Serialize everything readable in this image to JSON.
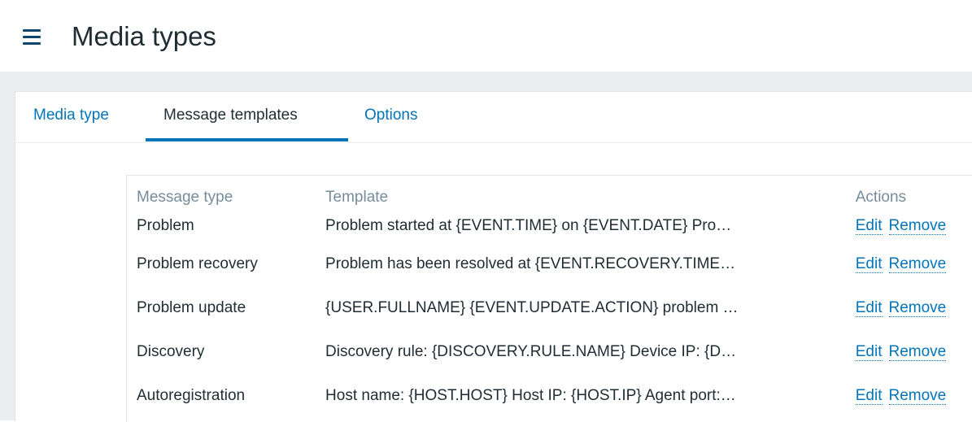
{
  "header": {
    "title": "Media types",
    "menu_icon": "hamburger-menu-icon"
  },
  "tabs": [
    {
      "label": "Media type",
      "active": false
    },
    {
      "label": "Message templates",
      "active": true
    },
    {
      "label": "Options",
      "active": false
    }
  ],
  "table": {
    "headers": {
      "message_type": "Message type",
      "template": "Template",
      "actions": "Actions"
    },
    "rows": [
      {
        "message_type": "Problem",
        "template": "Problem started at {EVENT.TIME} on {EVENT.DATE} Pro…",
        "edit": "Edit",
        "remove": "Remove"
      },
      {
        "message_type": "Problem recovery",
        "template": "Problem has been resolved at {EVENT.RECOVERY.TIME…",
        "edit": "Edit",
        "remove": "Remove"
      },
      {
        "message_type": "Problem update",
        "template": "{USER.FULLNAME} {EVENT.UPDATE.ACTION} problem …",
        "edit": "Edit",
        "remove": "Remove"
      },
      {
        "message_type": "Discovery",
        "template": "Discovery rule: {DISCOVERY.RULE.NAME} Device IP: {D…",
        "edit": "Edit",
        "remove": "Remove"
      },
      {
        "message_type": "Autoregistration",
        "template": "Host name: {HOST.HOST} Host IP: {HOST.IP} Agent port:…",
        "edit": "Edit",
        "remove": "Remove"
      }
    ]
  },
  "colors": {
    "link": "#0275b8",
    "text": "#1f2c33",
    "header_text": "#768d99",
    "background": "#ebeef0"
  }
}
